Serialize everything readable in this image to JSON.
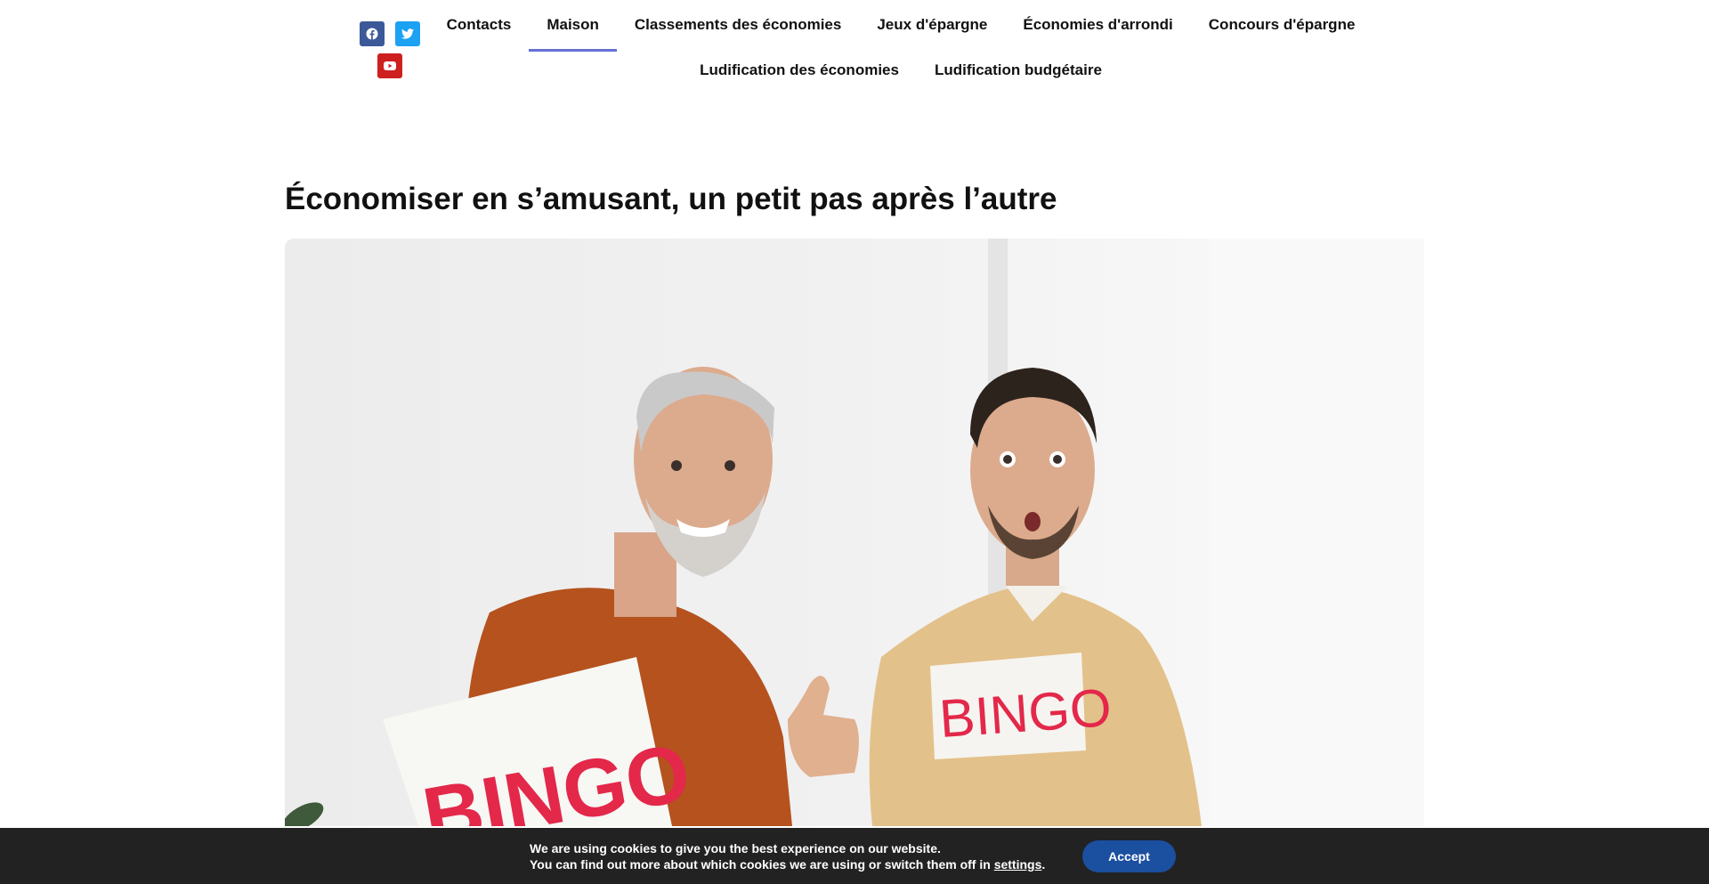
{
  "social": {
    "icons": [
      "facebook-icon",
      "twitter-icon",
      "youtube-icon"
    ],
    "colors": {
      "facebook": "#3b5998",
      "twitter": "#1da1f2",
      "youtube": "#cd201f"
    }
  },
  "nav": {
    "active_color": "#6470d6",
    "row1": [
      "Contacts",
      "Maison",
      "Classements des économies",
      "Jeux d'épargne",
      "Économies d'arrondi",
      "Concours d'épargne"
    ],
    "row2": [
      "Ludification des économies",
      "Ludification budgétaire"
    ],
    "active": "Maison"
  },
  "article": {
    "title": "Économiser en s’amusant, un petit pas après l’autre",
    "image": {
      "sign_left": "BINGO",
      "sign_right": "BINGO"
    }
  },
  "cookie": {
    "line1": "We are using cookies to give you the best experience on our website.",
    "line2_prefix": "You can find out more about which cookies we are using or switch them off in ",
    "settings_link": "settings",
    "line2_suffix": ".",
    "accept_label": "Accept",
    "accept_color": "#1b4fa0"
  }
}
